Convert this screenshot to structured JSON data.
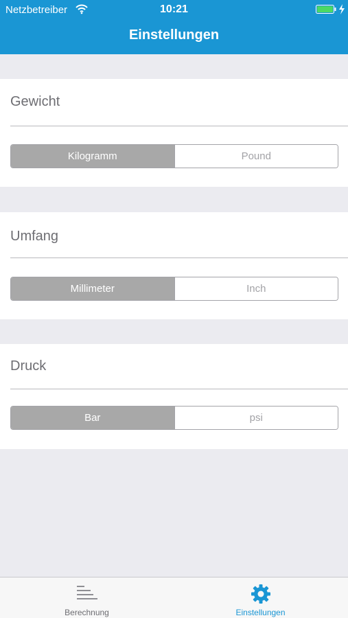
{
  "status_bar": {
    "carrier": "Netzbetreiber",
    "time": "10:21",
    "battery_color": "#4cd964"
  },
  "nav": {
    "title": "Einstellungen",
    "color": "#1a96d4"
  },
  "sections": [
    {
      "label": "Gewicht",
      "options": [
        "Kilogramm",
        "Pound"
      ],
      "selected": "Kilogramm"
    },
    {
      "label": "Umfang",
      "options": [
        "Millimeter",
        "Inch"
      ],
      "selected": "Millimeter"
    },
    {
      "label": "Druck",
      "options": [
        "Bar",
        "psi"
      ],
      "selected": "Bar"
    }
  ],
  "tabbar": {
    "tabs": [
      {
        "label": "Berechnung",
        "icon": "list-lines-icon",
        "active": false
      },
      {
        "label": "Einstellungen",
        "icon": "gear-icon",
        "active": true
      }
    ],
    "active_color": "#1a96d4",
    "inactive_color": "#8e8e93"
  }
}
